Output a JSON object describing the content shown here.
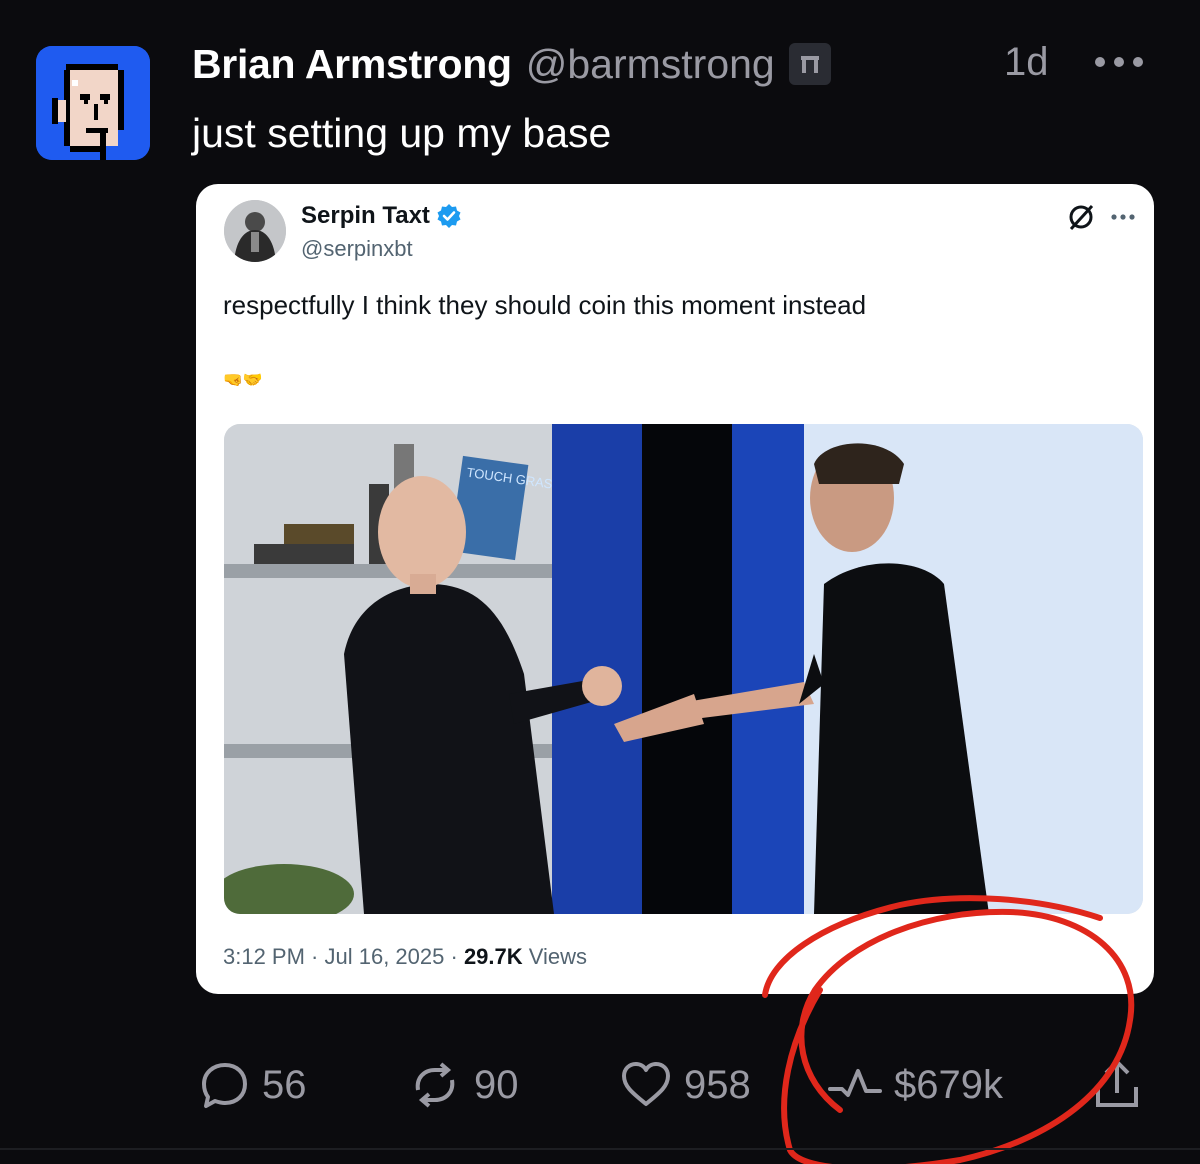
{
  "post": {
    "author_name": "Brian Armstrong",
    "author_handle": "@barmstrong",
    "time": "1d",
    "text": "just setting up my base"
  },
  "quoted": {
    "author_name": "Serpin Taxt",
    "author_handle": "@serpinxbt",
    "text": "respectfully I think they should coin this moment instead",
    "emojis": "🤜🤝",
    "photo_sign_text": "TOUCH GRASS",
    "meta_time": "3:12 PM",
    "meta_sep": " · ",
    "meta_date": "Jul 16, 2025",
    "meta_sep2": " · ",
    "views_count": "29.7K",
    "views_label": " Views"
  },
  "actions": {
    "replies": "56",
    "reposts": "90",
    "likes": "958",
    "value": "$679k"
  },
  "colors": {
    "background": "#0b0b0e",
    "avatar_bg": "#1f5bf0",
    "muted": "#9a9aa3",
    "annotation": "#e0271b"
  }
}
